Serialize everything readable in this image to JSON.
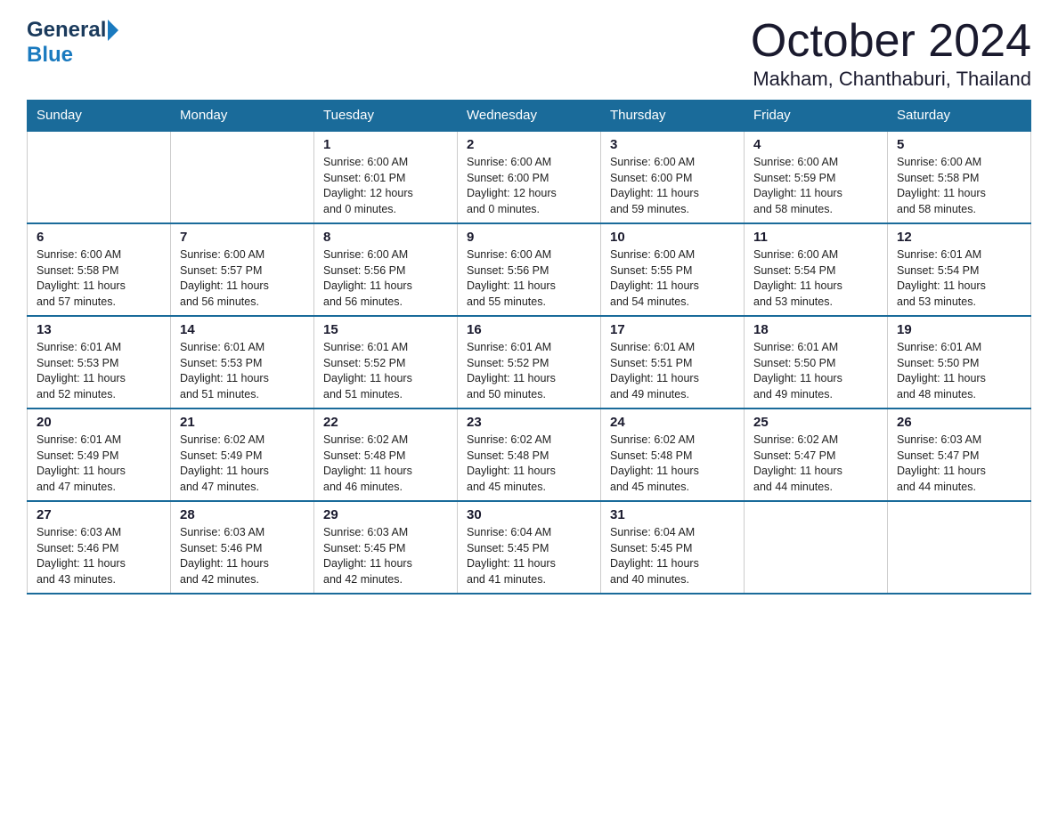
{
  "logo": {
    "general": "General",
    "blue": "Blue"
  },
  "header": {
    "month": "October 2024",
    "location": "Makham, Chanthaburi, Thailand"
  },
  "weekdays": [
    "Sunday",
    "Monday",
    "Tuesday",
    "Wednesday",
    "Thursday",
    "Friday",
    "Saturday"
  ],
  "weeks": [
    [
      {
        "day": "",
        "info": ""
      },
      {
        "day": "",
        "info": ""
      },
      {
        "day": "1",
        "info": "Sunrise: 6:00 AM\nSunset: 6:01 PM\nDaylight: 12 hours\nand 0 minutes."
      },
      {
        "day": "2",
        "info": "Sunrise: 6:00 AM\nSunset: 6:00 PM\nDaylight: 12 hours\nand 0 minutes."
      },
      {
        "day": "3",
        "info": "Sunrise: 6:00 AM\nSunset: 6:00 PM\nDaylight: 11 hours\nand 59 minutes."
      },
      {
        "day": "4",
        "info": "Sunrise: 6:00 AM\nSunset: 5:59 PM\nDaylight: 11 hours\nand 58 minutes."
      },
      {
        "day": "5",
        "info": "Sunrise: 6:00 AM\nSunset: 5:58 PM\nDaylight: 11 hours\nand 58 minutes."
      }
    ],
    [
      {
        "day": "6",
        "info": "Sunrise: 6:00 AM\nSunset: 5:58 PM\nDaylight: 11 hours\nand 57 minutes."
      },
      {
        "day": "7",
        "info": "Sunrise: 6:00 AM\nSunset: 5:57 PM\nDaylight: 11 hours\nand 56 minutes."
      },
      {
        "day": "8",
        "info": "Sunrise: 6:00 AM\nSunset: 5:56 PM\nDaylight: 11 hours\nand 56 minutes."
      },
      {
        "day": "9",
        "info": "Sunrise: 6:00 AM\nSunset: 5:56 PM\nDaylight: 11 hours\nand 55 minutes."
      },
      {
        "day": "10",
        "info": "Sunrise: 6:00 AM\nSunset: 5:55 PM\nDaylight: 11 hours\nand 54 minutes."
      },
      {
        "day": "11",
        "info": "Sunrise: 6:00 AM\nSunset: 5:54 PM\nDaylight: 11 hours\nand 53 minutes."
      },
      {
        "day": "12",
        "info": "Sunrise: 6:01 AM\nSunset: 5:54 PM\nDaylight: 11 hours\nand 53 minutes."
      }
    ],
    [
      {
        "day": "13",
        "info": "Sunrise: 6:01 AM\nSunset: 5:53 PM\nDaylight: 11 hours\nand 52 minutes."
      },
      {
        "day": "14",
        "info": "Sunrise: 6:01 AM\nSunset: 5:53 PM\nDaylight: 11 hours\nand 51 minutes."
      },
      {
        "day": "15",
        "info": "Sunrise: 6:01 AM\nSunset: 5:52 PM\nDaylight: 11 hours\nand 51 minutes."
      },
      {
        "day": "16",
        "info": "Sunrise: 6:01 AM\nSunset: 5:52 PM\nDaylight: 11 hours\nand 50 minutes."
      },
      {
        "day": "17",
        "info": "Sunrise: 6:01 AM\nSunset: 5:51 PM\nDaylight: 11 hours\nand 49 minutes."
      },
      {
        "day": "18",
        "info": "Sunrise: 6:01 AM\nSunset: 5:50 PM\nDaylight: 11 hours\nand 49 minutes."
      },
      {
        "day": "19",
        "info": "Sunrise: 6:01 AM\nSunset: 5:50 PM\nDaylight: 11 hours\nand 48 minutes."
      }
    ],
    [
      {
        "day": "20",
        "info": "Sunrise: 6:01 AM\nSunset: 5:49 PM\nDaylight: 11 hours\nand 47 minutes."
      },
      {
        "day": "21",
        "info": "Sunrise: 6:02 AM\nSunset: 5:49 PM\nDaylight: 11 hours\nand 47 minutes."
      },
      {
        "day": "22",
        "info": "Sunrise: 6:02 AM\nSunset: 5:48 PM\nDaylight: 11 hours\nand 46 minutes."
      },
      {
        "day": "23",
        "info": "Sunrise: 6:02 AM\nSunset: 5:48 PM\nDaylight: 11 hours\nand 45 minutes."
      },
      {
        "day": "24",
        "info": "Sunrise: 6:02 AM\nSunset: 5:48 PM\nDaylight: 11 hours\nand 45 minutes."
      },
      {
        "day": "25",
        "info": "Sunrise: 6:02 AM\nSunset: 5:47 PM\nDaylight: 11 hours\nand 44 minutes."
      },
      {
        "day": "26",
        "info": "Sunrise: 6:03 AM\nSunset: 5:47 PM\nDaylight: 11 hours\nand 44 minutes."
      }
    ],
    [
      {
        "day": "27",
        "info": "Sunrise: 6:03 AM\nSunset: 5:46 PM\nDaylight: 11 hours\nand 43 minutes."
      },
      {
        "day": "28",
        "info": "Sunrise: 6:03 AM\nSunset: 5:46 PM\nDaylight: 11 hours\nand 42 minutes."
      },
      {
        "day": "29",
        "info": "Sunrise: 6:03 AM\nSunset: 5:45 PM\nDaylight: 11 hours\nand 42 minutes."
      },
      {
        "day": "30",
        "info": "Sunrise: 6:04 AM\nSunset: 5:45 PM\nDaylight: 11 hours\nand 41 minutes."
      },
      {
        "day": "31",
        "info": "Sunrise: 6:04 AM\nSunset: 5:45 PM\nDaylight: 11 hours\nand 40 minutes."
      },
      {
        "day": "",
        "info": ""
      },
      {
        "day": "",
        "info": ""
      }
    ]
  ]
}
